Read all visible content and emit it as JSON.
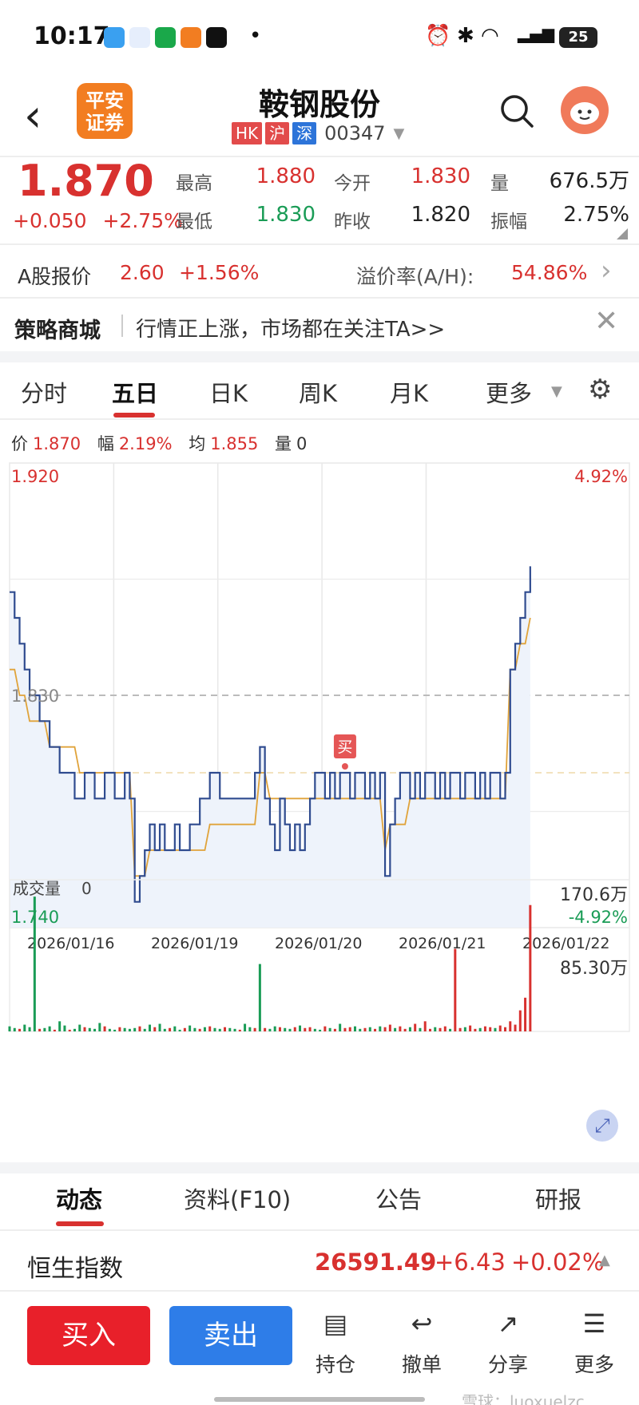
{
  "status_bar": {
    "time": "10:17",
    "battery": "25"
  },
  "header": {
    "back_label": "‹",
    "logo_text": "平安证券",
    "stock_name": "鞍钢股份",
    "badges": [
      "HK",
      "沪",
      "深"
    ],
    "code": "00347"
  },
  "quote": {
    "price": "1.870",
    "change": "+0.050",
    "change_pct": "+2.75%",
    "high_label": "最高",
    "high": "1.880",
    "low_label": "最低",
    "low": "1.830",
    "open_label": "今开",
    "open": "1.830",
    "prev_close_label": "昨收",
    "prev_close": "1.820",
    "volume_label": "量",
    "volume": "676.5万",
    "amplitude_label": "振幅",
    "amplitude": "2.75%"
  },
  "a_share": {
    "label": "A股报价",
    "price": "2.60",
    "change_pct": "+1.56%",
    "premium_label": "溢价率(A/H):",
    "premium": "54.86%"
  },
  "strategy": {
    "label": "策略商城",
    "text": "行情正上涨，市场都在关注TA>>"
  },
  "chart_tabs": [
    "分时",
    "五日",
    "日K",
    "周K",
    "月K",
    "更多"
  ],
  "active_tab": "五日",
  "readout": {
    "price_label": "价",
    "price": "1.870",
    "range_label": "幅",
    "range": "2.19%",
    "avg_label": "均",
    "avg": "1.855",
    "vol_label": "量",
    "vol": "0"
  },
  "colors": {
    "up": "#d8312f",
    "down": "#1a9c56",
    "price_line": "#2f4b8f",
    "avg_line": "#e0a33a"
  },
  "chart_data": [
    {
      "type": "line",
      "x_labels": [
        "2026/01/16",
        "2026/01/19",
        "2026/01/20",
        "2026/01/21",
        "2026/01/22"
      ],
      "y_left_labels": [
        "1.920",
        "1.830",
        "1.740"
      ],
      "y_right_labels": [
        "4.92%",
        "-4.92%"
      ],
      "ylim": [
        1.74,
        1.92
      ],
      "reference": 1.83,
      "marker": "买",
      "series": [
        {
          "name": "价",
          "values": [
            1.87,
            1.86,
            1.85,
            1.84,
            1.83,
            1.83,
            1.82,
            1.82,
            1.81,
            1.81,
            1.8,
            1.8,
            1.8,
            1.79,
            1.79,
            1.8,
            1.8,
            1.79,
            1.79,
            1.8,
            1.8,
            1.79,
            1.79,
            1.8,
            1.79,
            1.75,
            1.76,
            1.77,
            1.78,
            1.77,
            1.78,
            1.77,
            1.77,
            1.78,
            1.77,
            1.77,
            1.78,
            1.78,
            1.79,
            1.79,
            1.8,
            1.8,
            1.79,
            1.79,
            1.79,
            1.79,
            1.79,
            1.79,
            1.79,
            1.8,
            1.81,
            1.79,
            1.78,
            1.77,
            1.79,
            1.78,
            1.77,
            1.78,
            1.77,
            1.78,
            1.79,
            1.8,
            1.8,
            1.79,
            1.8,
            1.79,
            1.8,
            1.8,
            1.79,
            1.8,
            1.8,
            1.79,
            1.8,
            1.79,
            1.8,
            1.76,
            1.78,
            1.79,
            1.8,
            1.8,
            1.79,
            1.8,
            1.79,
            1.8,
            1.8,
            1.79,
            1.8,
            1.79,
            1.8,
            1.8,
            1.79,
            1.8,
            1.8,
            1.79,
            1.8,
            1.79,
            1.8,
            1.8,
            1.79,
            1.8,
            1.84,
            1.85,
            1.86,
            1.87,
            1.88
          ]
        },
        {
          "name": "均",
          "values": [
            1.84,
            1.84,
            1.83,
            1.83,
            1.82,
            1.82,
            1.82,
            1.82,
            1.81,
            1.81,
            1.81,
            1.81,
            1.81,
            1.81,
            1.8,
            1.8,
            1.8,
            1.8,
            1.8,
            1.8,
            1.8,
            1.8,
            1.8,
            1.8,
            1.8,
            1.76,
            1.76,
            1.76,
            1.77,
            1.77,
            1.77,
            1.77,
            1.77,
            1.77,
            1.77,
            1.77,
            1.77,
            1.77,
            1.77,
            1.77,
            1.78,
            1.78,
            1.78,
            1.78,
            1.78,
            1.78,
            1.78,
            1.78,
            1.78,
            1.78,
            1.8,
            1.8,
            1.79,
            1.79,
            1.79,
            1.79,
            1.79,
            1.79,
            1.79,
            1.79,
            1.79,
            1.79,
            1.79,
            1.79,
            1.79,
            1.79,
            1.79,
            1.79,
            1.79,
            1.79,
            1.79,
            1.79,
            1.79,
            1.79,
            1.79,
            1.77,
            1.78,
            1.78,
            1.78,
            1.78,
            1.79,
            1.79,
            1.79,
            1.79,
            1.79,
            1.79,
            1.79,
            1.79,
            1.79,
            1.79,
            1.79,
            1.79,
            1.79,
            1.79,
            1.79,
            1.79,
            1.79,
            1.79,
            1.79,
            1.79,
            1.84,
            1.84,
            1.85,
            1.85,
            1.86
          ]
        }
      ]
    },
    {
      "type": "bar",
      "title": "成交量",
      "current": "0",
      "y_labels": [
        "170.6万",
        "85.30万"
      ],
      "ylim": [
        0,
        170.6
      ],
      "values": [
        6,
        4,
        3,
        8,
        5,
        160,
        3,
        4,
        6,
        2,
        12,
        7,
        2,
        3,
        8,
        5,
        4,
        3,
        10,
        6,
        3,
        2,
        5,
        4,
        3,
        4,
        6,
        3,
        8,
        5,
        9,
        3,
        4,
        6,
        2,
        4,
        7,
        4,
        3,
        5,
        6,
        4,
        3,
        5,
        4,
        3,
        2,
        9,
        5,
        4,
        80,
        4,
        3,
        6,
        5,
        4,
        3,
        5,
        7,
        4,
        5,
        3,
        2,
        6,
        4,
        3,
        9,
        4,
        5,
        6,
        3,
        4,
        5,
        3,
        6,
        5,
        8,
        4,
        6,
        3,
        5,
        9,
        4,
        12,
        3,
        5,
        4,
        6,
        3,
        98,
        4,
        5,
        7,
        3,
        4,
        6,
        5,
        4,
        7,
        5,
        12,
        8,
        25,
        40,
        150
      ],
      "up_flags": [
        0,
        0,
        1,
        0,
        0,
        0,
        1,
        0,
        0,
        1,
        0,
        0,
        1,
        0,
        0,
        1,
        0,
        0,
        0,
        1,
        0,
        0,
        1,
        0,
        0,
        0,
        1,
        0,
        0,
        1,
        0,
        0,
        1,
        0,
        0,
        1,
        0,
        0,
        1,
        0,
        1,
        0,
        0,
        1,
        0,
        0,
        1,
        0,
        0,
        1,
        0,
        1,
        0,
        0,
        1,
        0,
        0,
        1,
        0,
        1,
        1,
        0,
        0,
        1,
        0,
        1,
        0,
        1,
        1,
        0,
        0,
        1,
        0,
        1,
        0,
        1,
        1,
        0,
        1,
        1,
        0,
        1,
        0,
        1,
        1,
        0,
        1,
        1,
        0,
        1,
        1,
        0,
        1,
        1,
        0,
        1,
        1,
        0,
        1,
        1,
        1,
        1,
        1,
        1,
        1
      ]
    }
  ],
  "bottom_tabs": [
    "动态",
    "资料(F10)",
    "公告",
    "研报"
  ],
  "index": {
    "name": "恒生指数",
    "value": "26591.49",
    "change": "+6.43",
    "change_pct": "+0.02%"
  },
  "actions": {
    "buy": "买入",
    "sell": "卖出",
    "position": "持仓",
    "cancel": "撤单",
    "share": "分享",
    "more": "更多"
  },
  "watermark": "雪球：luoxuelzc"
}
